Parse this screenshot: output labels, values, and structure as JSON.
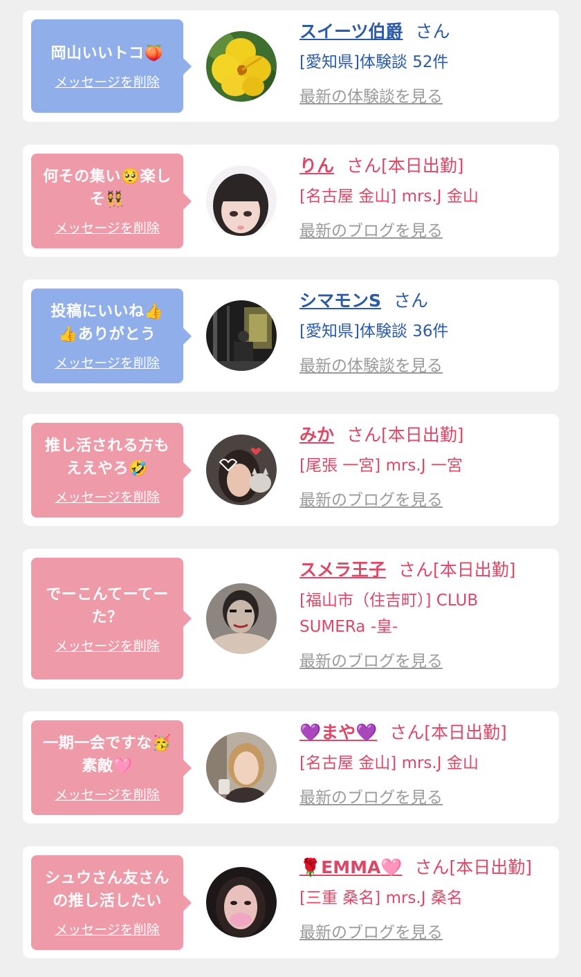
{
  "cards": [
    {
      "msg_line1": "岡山いいトコ🍑",
      "msg_line2": "",
      "delete_label": "メッセージを削除",
      "name": "スイーツ伯爵",
      "suffix": "さん",
      "shop_line1": "[愛知県]体験談 52件",
      "shop_line2": "",
      "link": "最新の体験談を見る"
    },
    {
      "msg_line1": "何その集い🥺楽し",
      "msg_line2": "そ👯",
      "delete_label": "メッセージを削除",
      "name": "りん",
      "suffix": "さん[本日出勤]",
      "shop_line1": "[名古屋 金山] mrs.J 金山",
      "shop_line2": "",
      "link": "最新のブログを見る"
    },
    {
      "msg_line1": "投稿にいいね👍",
      "msg_line2": "👍ありがとう",
      "delete_label": "メッセージを削除",
      "name": "シマモンS",
      "suffix": "さん",
      "shop_line1": "[愛知県]体験談 36件",
      "shop_line2": "",
      "link": "最新の体験談を見る"
    },
    {
      "msg_line1": "推し活される方も",
      "msg_line2": "ええやろ🤣",
      "delete_label": "メッセージを削除",
      "name": "みか",
      "suffix": "さん[本日出勤]",
      "shop_line1": "[尾張 一宮] mrs.J 一宮",
      "shop_line2": "",
      "link": "最新のブログを見る"
    },
    {
      "msg_line1": "でーこんてーてー",
      "msg_line2": "た？",
      "delete_label": "メッセージを削除",
      "name": "スメラ王子",
      "suffix": "さん[本日出勤]",
      "shop_line1": "[福山市（住吉町）] CLUB",
      "shop_line2": "SUMERa -皇-",
      "link": "最新のブログを見る"
    },
    {
      "msg_line1": "一期一会ですな🥳",
      "msg_line2": "素敵🩷",
      "delete_label": "メッセージを削除",
      "name": "💜まや💜",
      "suffix": "さん[本日出勤]",
      "shop_line1": "[名古屋 金山] mrs.J 金山",
      "shop_line2": "",
      "link": "最新のブログを見る"
    },
    {
      "msg_line1": "シュウさん友さん",
      "msg_line2": "の推し活したい",
      "delete_label": "メッセージを削除",
      "name": "🌹EMMA🩷",
      "suffix": "さん[本日出勤]",
      "shop_line1": "[三重 桑名] mrs.J 桑名",
      "shop_line2": "",
      "link": "最新のブログを見る"
    }
  ],
  "colors": {
    "blue_bubble": "#8faeea",
    "pink_bubble": "#ef9aa8",
    "blue_text": "#2a5aa8",
    "pink_text": "#dd4766",
    "link_gray": "#9a9a9a",
    "background": "#efeff0"
  }
}
